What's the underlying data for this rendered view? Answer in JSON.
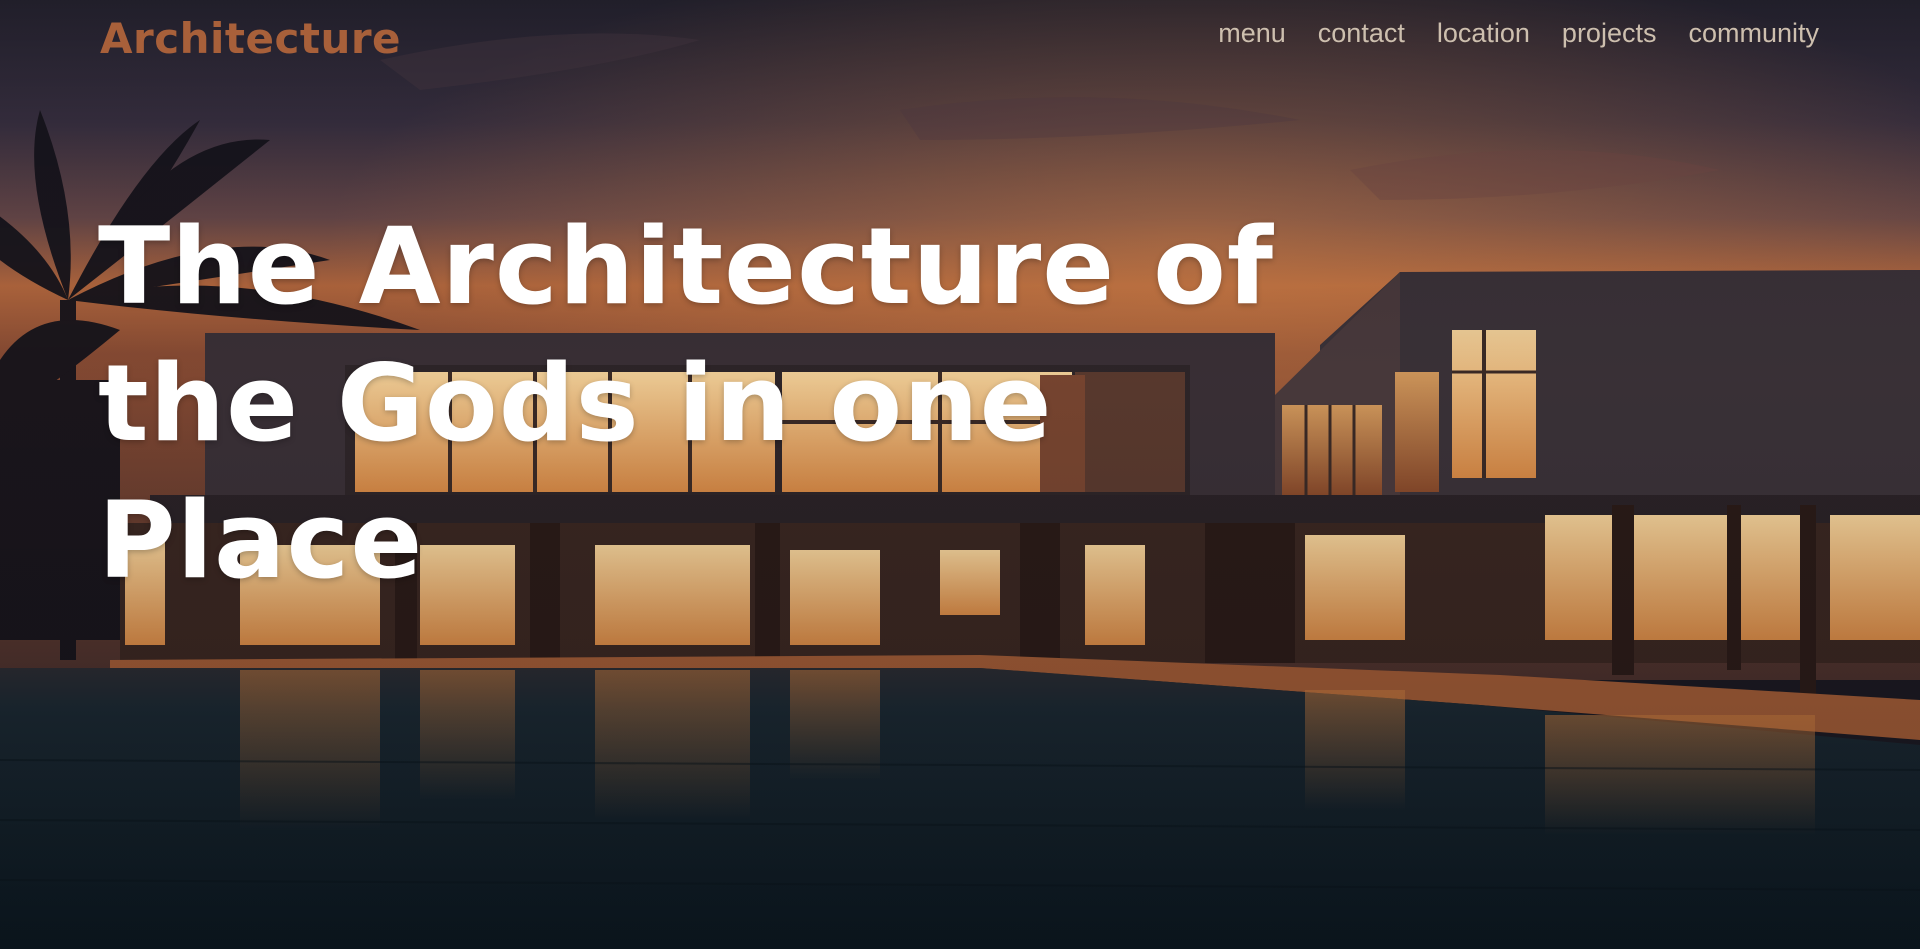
{
  "site": {
    "logo_text": "Architecture"
  },
  "nav": {
    "items": [
      {
        "label": "menu"
      },
      {
        "label": "contact"
      },
      {
        "label": "location"
      },
      {
        "label": "projects"
      },
      {
        "label": "community"
      }
    ]
  },
  "hero": {
    "headline": "The Architecture of the Gods in one Place",
    "background_image": "modern-villa-at-dusk-with-pool"
  },
  "colors": {
    "logo": "#a8603a",
    "nav_text": "#cdbfae",
    "headline": "#ffffff",
    "sky_top": "#2a2838",
    "sky_glow": "#c9743e",
    "water": "#0f1d26"
  }
}
